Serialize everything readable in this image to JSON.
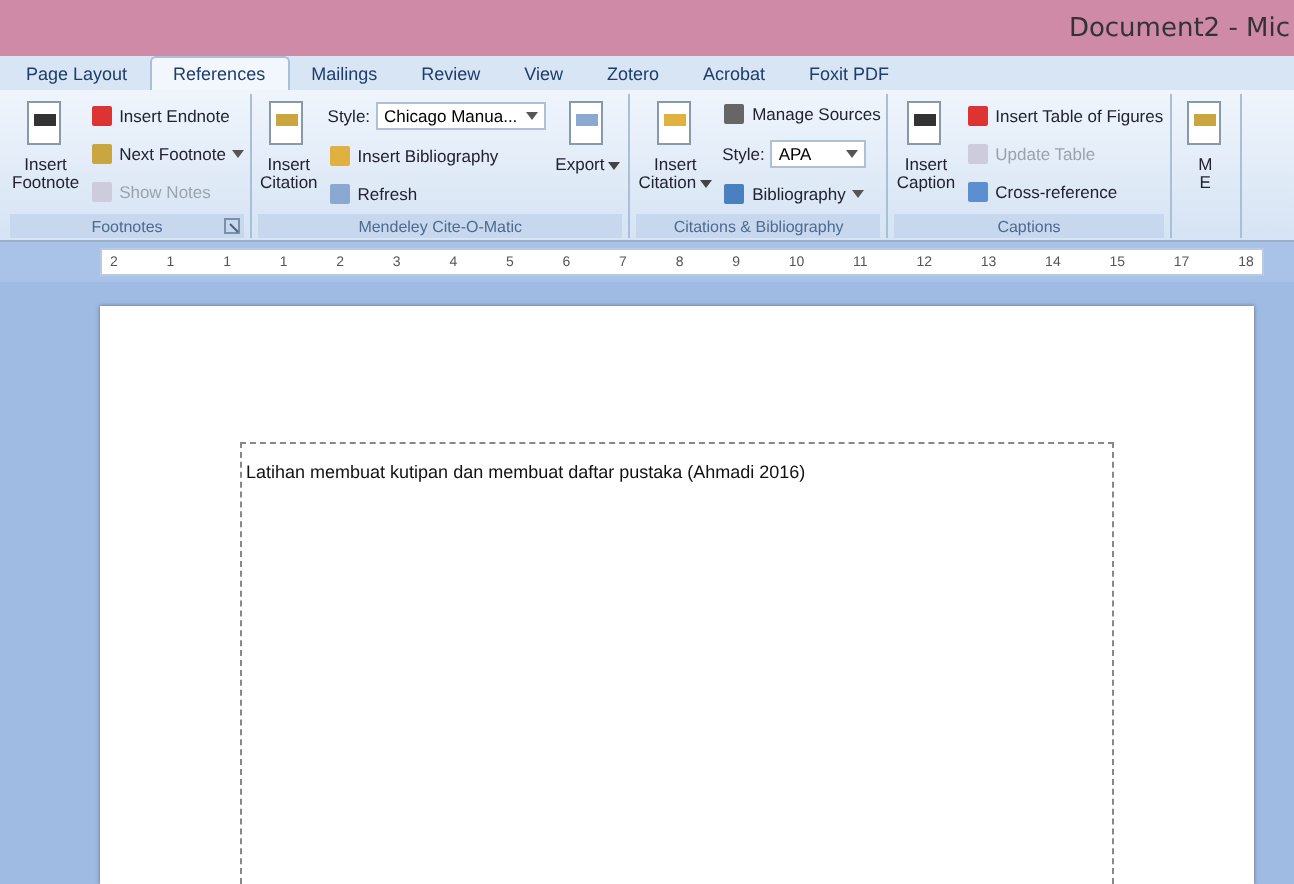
{
  "window": {
    "title": "Document2 - Mic"
  },
  "tabs": [
    {
      "label": "Page Layout",
      "selected": false
    },
    {
      "label": "References",
      "selected": true
    },
    {
      "label": "Mailings",
      "selected": false
    },
    {
      "label": "Review",
      "selected": false
    },
    {
      "label": "View",
      "selected": false
    },
    {
      "label": "Zotero",
      "selected": false
    },
    {
      "label": "Acrobat",
      "selected": false
    },
    {
      "label": "Foxit PDF",
      "selected": false
    }
  ],
  "ribbon_groups": [
    {
      "label": "Footnotes",
      "launcher": true,
      "items": [
        {
          "kind": "large",
          "lines": [
            "Insert",
            "Footnote"
          ],
          "dropdown": false
        },
        {
          "kind": "column",
          "items": [
            {
              "kind": "button",
              "label": "Insert Endnote",
              "disabled": false,
              "dropdown": false
            },
            {
              "kind": "button",
              "label": "Next Footnote",
              "disabled": false,
              "dropdown": true
            },
            {
              "kind": "button",
              "label": "Show Notes",
              "disabled": true,
              "dropdown": false
            }
          ]
        }
      ]
    },
    {
      "label": "Mendeley Cite-O-Matic",
      "launcher": false,
      "items": [
        {
          "kind": "large",
          "lines": [
            "Insert",
            "Citation"
          ],
          "dropdown": false
        },
        {
          "kind": "column",
          "items": [
            {
              "kind": "style",
              "label": "Style:",
              "value": "Chicago Manua..."
            },
            {
              "kind": "button",
              "label": "Insert Bibliography",
              "disabled": false,
              "dropdown": false
            },
            {
              "kind": "button",
              "label": "Refresh",
              "disabled": false,
              "dropdown": false
            }
          ]
        },
        {
          "kind": "large",
          "lines": [
            "Export"
          ],
          "dropdown": true
        }
      ]
    },
    {
      "label": "Citations & Bibliography",
      "launcher": false,
      "items": [
        {
          "kind": "large",
          "lines": [
            "Insert",
            "Citation"
          ],
          "dropdown": true
        },
        {
          "kind": "column",
          "items": [
            {
              "kind": "button",
              "label": "Manage Sources",
              "disabled": false,
              "dropdown": false
            },
            {
              "kind": "style",
              "label": "Style:",
              "value": "APA"
            },
            {
              "kind": "button",
              "label": "Bibliography",
              "disabled": false,
              "dropdown": true
            }
          ]
        }
      ]
    },
    {
      "label": "Captions",
      "launcher": false,
      "items": [
        {
          "kind": "large",
          "lines": [
            "Insert",
            "Caption"
          ],
          "dropdown": false
        },
        {
          "kind": "column",
          "items": [
            {
              "kind": "button",
              "label": "Insert Table of Figures",
              "disabled": false,
              "dropdown": false
            },
            {
              "kind": "button",
              "label": "Update Table",
              "disabled": true,
              "dropdown": false
            },
            {
              "kind": "button",
              "label": "Cross-reference",
              "disabled": false,
              "dropdown": false
            }
          ]
        }
      ]
    },
    {
      "items": [
        {
          "kind": "large",
          "lines": [
            "M",
            "E"
          ],
          "dropdown": false
        }
      ]
    }
  ],
  "ruler": [
    "2",
    "1",
    "1",
    "1",
    "2",
    "3",
    "4",
    "5",
    "6",
    "7",
    "8",
    "9",
    "10",
    "11",
    "12",
    "13",
    "14",
    "15",
    "17",
    "18"
  ],
  "document": {
    "text": "Latihan membuat kutipan dan membuat daftar pustaka (Ahmadi 2016)"
  }
}
